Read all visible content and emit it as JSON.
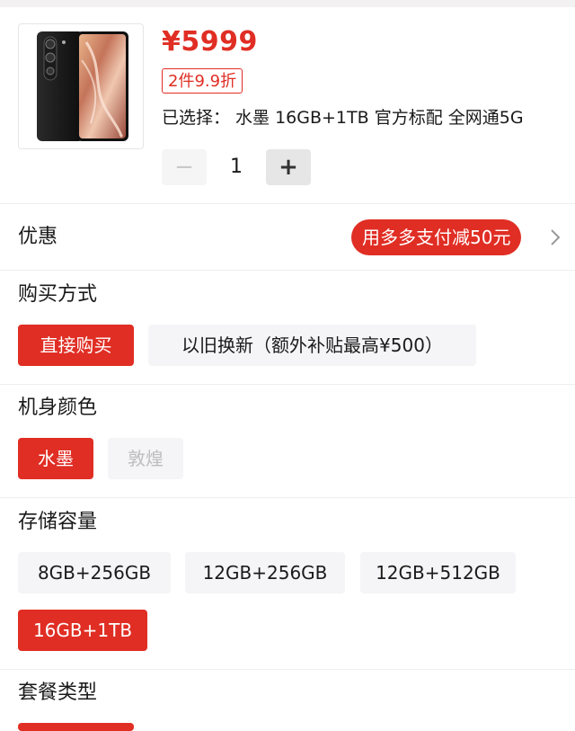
{
  "product": {
    "price": "¥5999",
    "discount_tag": "2件9.9折",
    "selected_text": "已选择： 水墨 16GB+1TB 官方标配 全网通5G",
    "quantity": "1",
    "minus_symbol": "−",
    "plus_symbol": "+",
    "thumbnail_icon": "phone-image-icon"
  },
  "promo": {
    "title": "优惠",
    "pill_label": "用多多支付减50元",
    "chevron_icon": "chevron-right-icon"
  },
  "purchase": {
    "title": "购买方式",
    "options": [
      {
        "label": "直接购买",
        "state": "active"
      },
      {
        "label": "以旧换新（额外补贴最高¥500）",
        "state": "normal"
      }
    ]
  },
  "color": {
    "title": "机身颜色",
    "options": [
      {
        "label": "水墨",
        "state": "active"
      },
      {
        "label": "敦煌",
        "state": "disabled"
      }
    ]
  },
  "storage": {
    "title": "存储容量",
    "options": [
      {
        "label": "8GB+256GB",
        "state": "normal"
      },
      {
        "label": "12GB+256GB",
        "state": "normal"
      },
      {
        "label": "12GB+512GB",
        "state": "normal"
      },
      {
        "label": "16GB+1TB",
        "state": "active"
      }
    ]
  },
  "package": {
    "title": "套餐类型"
  },
  "colors": {
    "accent": "#e02e24",
    "chip_bg": "#f5f4f6",
    "disabled_text": "#bdbdbd"
  }
}
